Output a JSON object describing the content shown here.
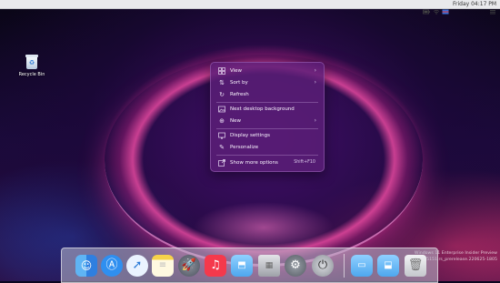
{
  "menubar": {
    "clock": "Friday 04:17 PM",
    "icons": [
      "apple-icon",
      "battery-icon",
      "wifi-icon",
      "flag-icon",
      "search-icon",
      "menu-icon"
    ]
  },
  "desktop": {
    "icons": [
      {
        "label": "Recycle Bin",
        "icon": "recycle-bin-icon"
      }
    ]
  },
  "context_menu": {
    "items": [
      {
        "label": "View",
        "icon": "grid-icon",
        "submenu": true
      },
      {
        "label": "Sort by",
        "icon": "sort-icon",
        "submenu": true
      },
      {
        "label": "Refresh",
        "icon": "refresh-icon"
      },
      {
        "label": "Next desktop background",
        "icon": "image-icon"
      },
      {
        "label": "New",
        "icon": "plus-icon",
        "submenu": true
      },
      {
        "label": "Display settings",
        "icon": "display-icon"
      },
      {
        "label": "Personalize",
        "icon": "brush-icon"
      },
      {
        "label": "Show more options",
        "icon": "share-icon",
        "shortcut": "Shift+F10"
      }
    ]
  },
  "watermark": {
    "line1": "Windows 11 Enterprise Insider Preview",
    "line2": "Build 25151.rs_prerelease.220625-1805"
  },
  "dock": {
    "items": [
      "finder",
      "app-store",
      "safari",
      "notes",
      "launchpad",
      "music",
      "folder",
      "mac-pro",
      "system-preferences",
      "power",
      "folder",
      "folder",
      "trash"
    ]
  }
}
